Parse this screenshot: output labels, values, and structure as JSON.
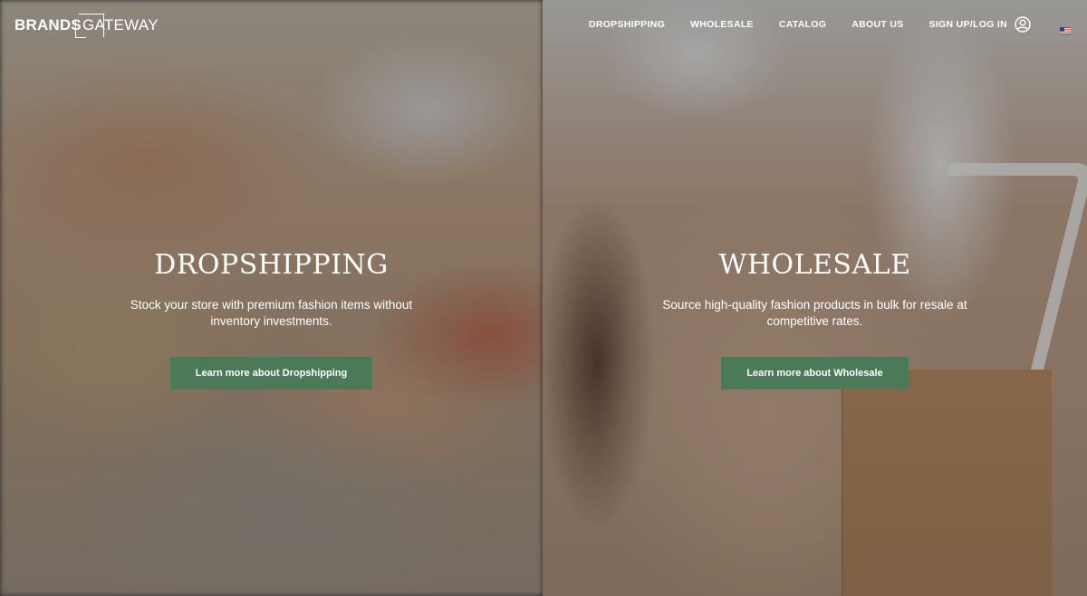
{
  "header": {
    "logo": {
      "part1": "BRANDS",
      "part2": "GATEWAY"
    },
    "nav": [
      {
        "label": "DROPSHIPPING"
      },
      {
        "label": "WHOLESALE"
      },
      {
        "label": "CATALOG"
      },
      {
        "label": "ABOUT US"
      },
      {
        "label": "SIGN UP/LOG IN"
      }
    ],
    "icons": {
      "account": "user-circle-icon",
      "language": "us-flag-icon"
    }
  },
  "panels": {
    "dropshipping": {
      "title": "DROPSHIPPING",
      "description": "Stock your store with premium fashion items without inventory investments.",
      "cta": "Learn more about Dropshipping"
    },
    "wholesale": {
      "title": "WHOLESALE",
      "description": "Source high-quality fashion products in bulk for resale at competitive rates.",
      "cta": "Learn more about Wholesale"
    }
  },
  "colors": {
    "button": "#4b7a58",
    "text": "#ffffff",
    "overlay": "rgba(0,0,0,0.30)"
  }
}
